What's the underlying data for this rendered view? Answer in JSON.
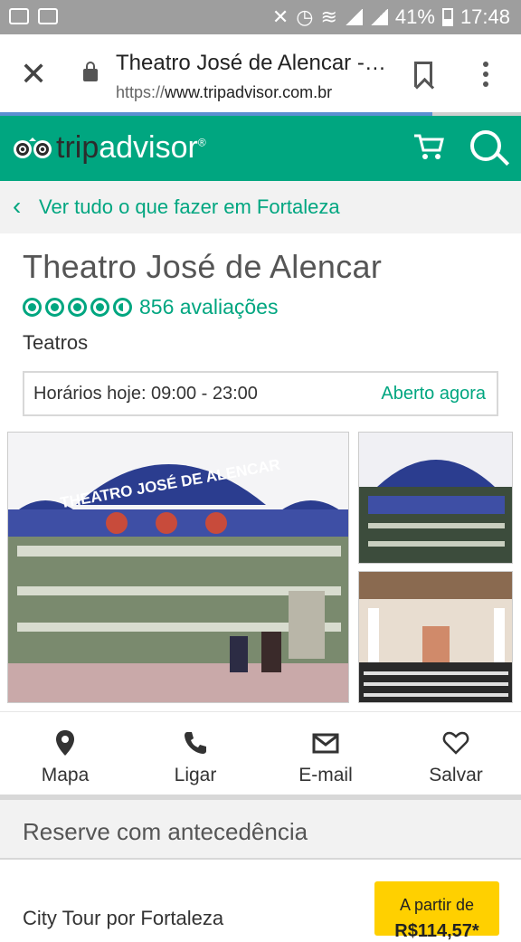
{
  "status_bar": {
    "battery": "41%",
    "time": "17:48"
  },
  "browser": {
    "page_title": "Theatro José de Alencar - Fortaleza",
    "url_prefix": "https://",
    "url_domain": "www.tripadvisor.com.br",
    "load_progress": 0.83
  },
  "header": {
    "logo_trip": "trip",
    "logo_advisor": "advisor",
    "logo_reg": "®"
  },
  "back_link": {
    "label": "Ver tudo o que fazer em Fortaleza"
  },
  "attraction": {
    "title": "Theatro José de Alencar",
    "rating": 4.5,
    "reviews": "856 avaliações",
    "category": "Teatros",
    "hours_label": "Horários hoje: 09:00 - 23:00",
    "open_status": "Aberto agora"
  },
  "photo_facade_text": "THEATRO JOSÉ DE ALENCAR",
  "actions": [
    {
      "label": "Mapa",
      "icon": "map-pin-icon"
    },
    {
      "label": "Ligar",
      "icon": "phone-icon"
    },
    {
      "label": "E-mail",
      "icon": "mail-icon"
    },
    {
      "label": "Salvar",
      "icon": "heart-icon"
    }
  ],
  "reserve": {
    "title": "Reserve com antecedência",
    "tour_name": "City Tour por Fortaleza",
    "price_from": "A partir de",
    "price": "R$114,57*"
  },
  "colors": {
    "brand_green": "#00a680",
    "status_gray": "#9e9e9e",
    "price_yellow": "#ffd000"
  }
}
